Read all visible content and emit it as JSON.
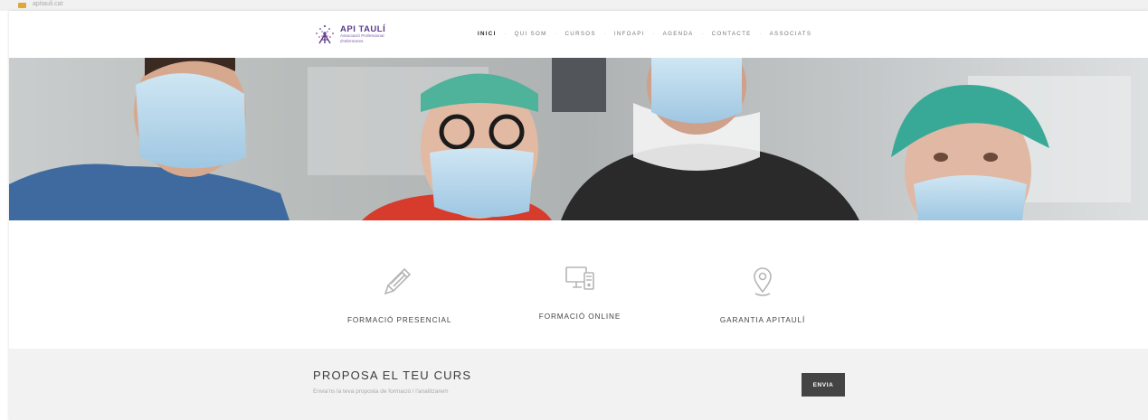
{
  "browser": {
    "tab_text": "apitauli.cat"
  },
  "logo": {
    "title": "API TAULÍ",
    "subtitle_line1": "Associació Professional",
    "subtitle_line2": "d'Infermeres"
  },
  "nav": {
    "items": [
      {
        "label": "INICI",
        "active": true
      },
      {
        "label": "QUI SOM",
        "active": false
      },
      {
        "label": "CURSOS",
        "active": false
      },
      {
        "label": "INFOAPI",
        "active": false
      },
      {
        "label": "AGENDA",
        "active": false
      },
      {
        "label": "CONTACTE",
        "active": false
      },
      {
        "label": "ASSOCIATS",
        "active": false
      }
    ],
    "separator": "·"
  },
  "features": [
    {
      "label": "FORMACIÓ PRESENCIAL",
      "icon": "pencil-icon"
    },
    {
      "label": "FORMACIÓ ONLINE",
      "icon": "computer-icon"
    },
    {
      "label": "GARANTIA APITAULÍ",
      "icon": "location-pin-icon"
    }
  ],
  "cta": {
    "title": "PROPOSA EL TEU CURS",
    "subtitle": "Envia'ns la teva proposta de formació i l'analitzarem",
    "button_label": "ENVIA"
  },
  "colors": {
    "brand_purple": "#5b3c8c",
    "cta_background": "#f2f2f2",
    "button_background": "#444444",
    "icon_gray": "#b5b5b5"
  }
}
